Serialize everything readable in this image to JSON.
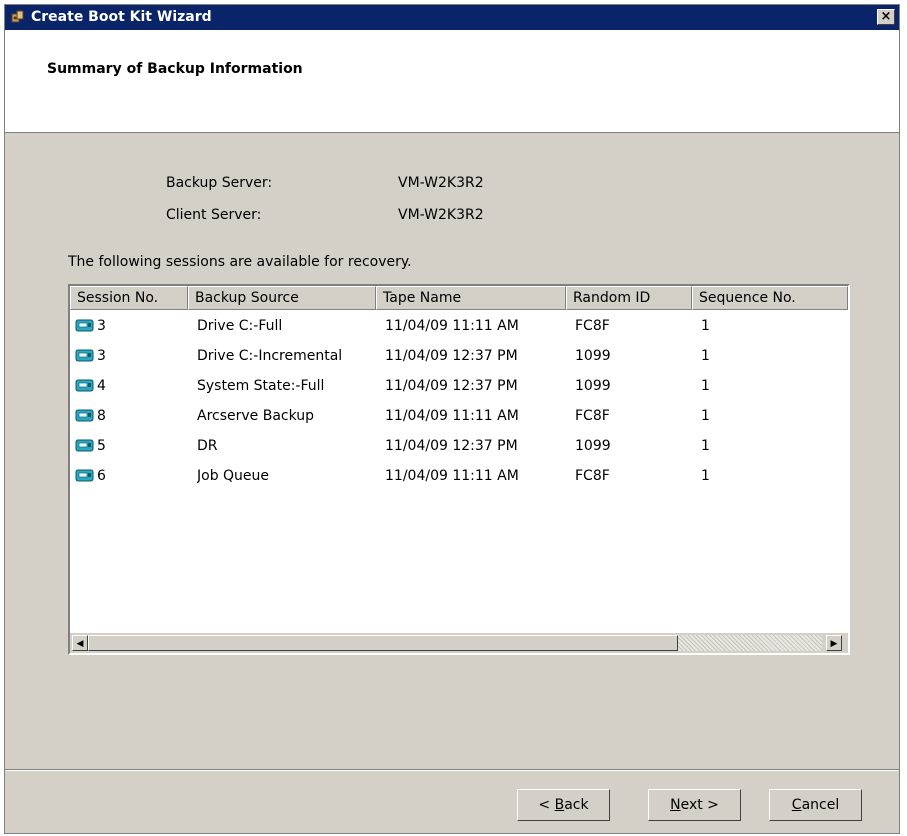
{
  "window": {
    "title": "Create Boot Kit Wizard",
    "close_label": "×"
  },
  "header": {
    "title": "Summary of Backup Information"
  },
  "info": {
    "backup_server_label": "Backup Server:",
    "backup_server_value": "VM-W2K3R2",
    "client_server_label": "Client Server:",
    "client_server_value": "VM-W2K3R2"
  },
  "sessions_intro": "The following sessions are available for recovery.",
  "table": {
    "columns": [
      "Session No.",
      "Backup Source",
      "Tape Name",
      "Random ID",
      "Sequence No."
    ],
    "rows": [
      {
        "session": "3",
        "source": "Drive C:-Full",
        "tape": "11/04/09 11:11 AM",
        "random_id": "FC8F",
        "sequence": "1"
      },
      {
        "session": "3",
        "source": "Drive C:-Incremental",
        "tape": "11/04/09 12:37 PM",
        "random_id": "1099",
        "sequence": "1"
      },
      {
        "session": "4",
        "source": "System State:-Full",
        "tape": "11/04/09 12:37 PM",
        "random_id": "1099",
        "sequence": "1"
      },
      {
        "session": "8",
        "source": "Arcserve Backup",
        "tape": "11/04/09 11:11 AM",
        "random_id": "FC8F",
        "sequence": "1"
      },
      {
        "session": "5",
        "source": "DR",
        "tape": "11/04/09 12:37 PM",
        "random_id": "1099",
        "sequence": "1"
      },
      {
        "session": "6",
        "source": "Job Queue",
        "tape": "11/04/09 11:11 AM",
        "random_id": "FC8F",
        "sequence": "1"
      }
    ]
  },
  "scrollbar": {
    "left_arrow": "◀",
    "right_arrow": "▶"
  },
  "buttons": {
    "back_prefix": "< ",
    "back_key": "B",
    "back_rest": "ack",
    "next_key": "N",
    "next_rest": "ext >",
    "cancel_key": "C",
    "cancel_rest": "ancel"
  },
  "icons": {
    "title": "wizard-app-icon",
    "session": "tape-session-icon"
  }
}
